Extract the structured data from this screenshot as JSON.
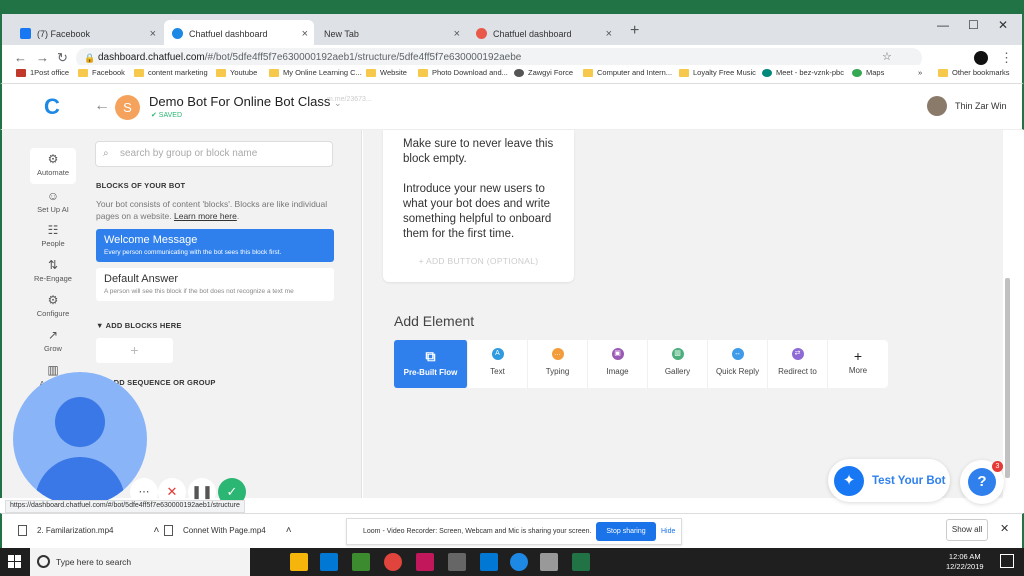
{
  "browser": {
    "tabs": [
      {
        "label": "(7) Facebook",
        "color": "#1877f2"
      },
      {
        "label": "Chatfuel dashboard",
        "color": "#1e88e5"
      },
      {
        "label": "New Tab",
        "color": "#dee1e6"
      },
      {
        "label": "Chatfuel dashboard",
        "color": "#e8594a"
      }
    ],
    "url_host": "dashboard.chatfuel.com",
    "url_path": "/#/bot/5dfe4ff5f7e630000192aeb1/structure/5dfe4ff5f7e630000192aebe",
    "bookmarks": [
      "1Post office",
      "Facebook",
      "content marketing",
      "Youtube",
      "My Online Learning C...",
      "Website",
      "Photo Download and...",
      "Zawgyi Force",
      "Computer and Intern...",
      "Loyalty Free Music",
      "Meet - bez-vznk-pbc",
      "Maps",
      "Other bookmarks"
    ],
    "bookmarks_overflow": "»"
  },
  "header": {
    "logo": "C",
    "bot_initial": "S",
    "bot_name": "Demo Bot For Online Bot Class",
    "saved": "✔ SAVED",
    "mme_link": "m.me/23673...",
    "user_name": "Thin Zar Win"
  },
  "leftnav": [
    {
      "label": "Automate",
      "icon": "⚙"
    },
    {
      "label": "Set Up AI",
      "icon": "☺"
    },
    {
      "label": "People",
      "icon": "☷"
    },
    {
      "label": "Re-Engage",
      "icon": "⇅"
    },
    {
      "label": "Configure",
      "icon": "⚙"
    },
    {
      "label": "Grow",
      "icon": "↗"
    },
    {
      "label": "Analyze",
      "icon": "▥"
    }
  ],
  "blocks": {
    "search_placeholder": "search by group or block name",
    "heading": "BLOCKS OF YOUR BOT",
    "desc": "Your bot consists of content 'blocks'. Blocks are like individual pages on a website.",
    "learn_more": "Learn more here",
    "welcome_title": "Welcome Message",
    "welcome_sub": "Every person communicating with the bot sees this block first.",
    "default_title": "Default Answer",
    "default_sub": "A person will see this block if the bot does not recognize a text me",
    "add_blocks": "▼  ADD BLOCKS HERE",
    "add_plus": "+",
    "add_seq": "ADD SEQUENCE OR GROUP"
  },
  "card": {
    "text1": "Make sure to never leave this block empty.",
    "text2": "Introduce your new users to what your bot does and write something helpful to onboard them for the first time.",
    "add_button": "+  ADD BUTTON (OPTIONAL)"
  },
  "add_element": {
    "title": "Add Element",
    "items": [
      {
        "label": "Pre-Built Flow",
        "color": "#2f80ed"
      },
      {
        "label": "Text",
        "color": "#2f9ae0"
      },
      {
        "label": "Typing",
        "color": "#f39c3c"
      },
      {
        "label": "Image",
        "color": "#9b59b6"
      },
      {
        "label": "Gallery",
        "color": "#4caf7d"
      },
      {
        "label": "Quick Reply",
        "color": "#3d9be9"
      },
      {
        "label": "Redirect to",
        "color": "#8e6bd4"
      },
      {
        "label": "More",
        "color": "#222222"
      }
    ]
  },
  "floating": {
    "test_bot": "Test Your Bot",
    "help_badge": "3",
    "help_q": "?"
  },
  "status_url": "https://dashboard.chatfuel.com/#/bot/5dfe4ff5f7e630000192aeb1/structure",
  "downloads": {
    "items": [
      "2. Familarization.mp4",
      "Connet With Page.mp4"
    ],
    "loom_text": "Loom - Video Recorder: Screen, Webcam and Mic is sharing your screen.",
    "stop_sharing": "Stop sharing",
    "hide": "Hide",
    "show_all": "Show all"
  },
  "taskbar": {
    "search": "Type here to search",
    "time": "12:06 AM",
    "date": "12/22/2019"
  }
}
